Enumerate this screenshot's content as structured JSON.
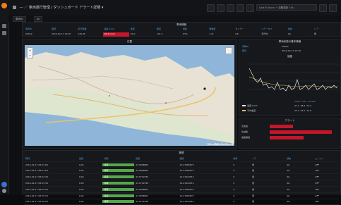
{
  "brand_mark": "",
  "topbar": {
    "breadcrumb": "— ／ 車両運行管理 / ダッシュボード",
    "dashboard_name": "アラート詳細 ▾",
    "time_range": "Last 6 hours ～ 自動更新 10s"
  },
  "subbar": {
    "vehicle_label": "車両ID",
    "vehicle_value": "All"
  },
  "info_panel": {
    "title": "車両情報",
    "headers": [
      "車両ID",
      "時刻",
      "走行距離",
      "速度 km/h",
      "緯度",
      "経度",
      "燃料",
      "積載量",
      "センサー",
      "ステータス",
      "通信",
      "ドア"
    ],
    "values": [
      "V0012",
      "2019-02-17 13:45",
      "129.45",
      "98.4 km/h",
      "43.0",
      "141.3",
      "63%",
      "1.2t",
      "OK",
      "走行中",
      "4G",
      "閉"
    ]
  },
  "map_panel": {
    "title": "位置",
    "attribution": "Leaflet | © OpenStreetMap"
  },
  "detail_panel": {
    "title": "車両状態の基本情報",
    "row1_label": "車両ID",
    "row1_value": "V0012",
    "row2_label": "時刻",
    "row2_value": "2019-02-17 13:45",
    "chart_title": "速度",
    "series1_name": "速度 km/h",
    "series2_name": "平均速度",
    "stat_headers": [
      "mean",
      "max",
      "current"
    ],
    "stat1": [
      "47.1",
      "98.4",
      "52.3"
    ],
    "stat2": [
      "43.2",
      "61.0",
      "44.8"
    ]
  },
  "alert_panel": {
    "title": "アラート",
    "rows": [
      {
        "label": "急加速",
        "fraction": 0.38
      },
      {
        "label": "急減速",
        "fraction": 1.0
      },
      {
        "label": "速度超過",
        "fraction": 0.55
      }
    ]
  },
  "table_panel": {
    "title": "履歴",
    "headers": [
      "時刻",
      "速度",
      "状態",
      "緯度",
      "経度",
      "燃料",
      "ドア",
      "通信",
      "エンジン"
    ],
    "rows": [
      [
        "2019-02-17 08:21:06",
        "0.00",
        "停車",
        "43.0698805",
        "141.3380673",
        "0",
        "閉",
        "4G",
        "OFF"
      ],
      [
        "2019-02-17 08:21:56",
        "0.00",
        "停車",
        "43.0698805",
        "141.3380673",
        "0",
        "閉",
        "4G",
        "OFF"
      ],
      [
        "2019-02-17 08:22:46",
        "0.00",
        "停車",
        "43.0712534",
        "141.3424512",
        "0",
        "閉",
        "4G",
        "OFF"
      ],
      [
        "2019-02-17 08:23:36",
        "0.00",
        "停車",
        "43.0712534",
        "141.3424512",
        "0",
        "閉",
        "4G",
        "OFF"
      ],
      [
        "2019-02-17 08:24:26",
        "0.00",
        "停車",
        "43.0698801",
        "141.3380672",
        "0",
        "閉",
        "4G",
        "OFF"
      ],
      [
        "2019-02-17 08:25:16",
        "0.00",
        "停車",
        "43.0698801",
        "141.3380672",
        "0",
        "閉",
        "4G",
        "OFF"
      ],
      [
        "2019-02-17 08:26:06",
        "0.00",
        "停車",
        "43.0712530",
        "141.3424510",
        "0",
        "閉",
        "4G",
        "OFF"
      ]
    ]
  },
  "colors": {
    "accent_red": "#c4162a",
    "accent_green": "#56a64b",
    "series_white": "#e8e8e8",
    "series_yellow": "#e0c35a",
    "header_blue": "#5aa0d8"
  }
}
